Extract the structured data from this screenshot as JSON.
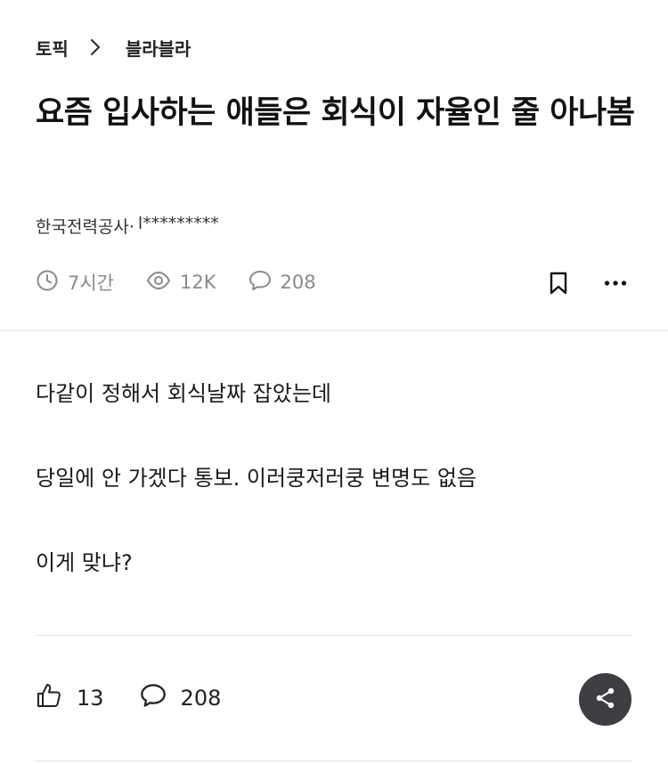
{
  "breadcrumb": {
    "root": "토픽",
    "current": "블라블라"
  },
  "post": {
    "title": "요즘 입사하는 애들은 회식이 자율인 줄 아나봄",
    "author_company": "한국전력공사·",
    "author_name": "l*********",
    "time_ago": "7시간",
    "views": "12K",
    "comments": "208",
    "body_lines": [
      "다같이 정해서 회식날짜 잡았는데",
      "당일에 안 가겠다 통보. 이러쿵저러쿵 변명도 없음",
      "이게 맞냐?"
    ]
  },
  "actions": {
    "likes": "13",
    "comments": "208"
  },
  "icons": {
    "breadcrumb_separator": "chevron-right-icon",
    "time": "clock-icon",
    "views": "eye-icon",
    "comments": "speech-bubble-icon",
    "bookmark": "bookmark-icon",
    "more": "more-horizontal-icon",
    "like": "thumbs-up-icon",
    "share": "share-icon"
  },
  "colors": {
    "text_primary": "#111111",
    "text_secondary": "#8a8a8a",
    "share_button_bg": "#3d3d42",
    "divider": "#e9e9e9"
  }
}
